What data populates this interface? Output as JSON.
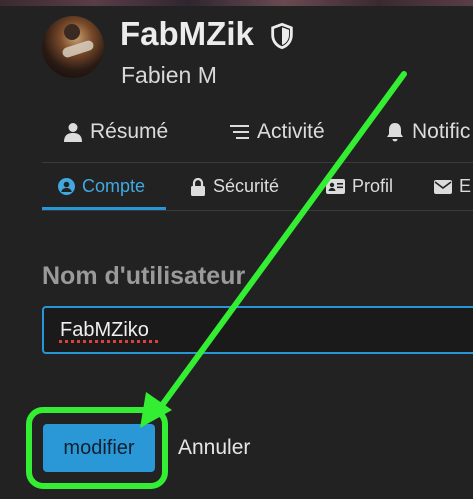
{
  "profile": {
    "username": "FabMZik",
    "real_name": "Fabien M"
  },
  "nav_primary": [
    {
      "label": "Résumé",
      "icon": "user-icon"
    },
    {
      "label": "Activité",
      "icon": "activity-list-icon"
    },
    {
      "label": "Notific",
      "icon": "bell-icon"
    }
  ],
  "nav_secondary": [
    {
      "label": "Compte",
      "icon": "user-circle-icon",
      "active": true
    },
    {
      "label": "Sécurité",
      "icon": "lock-icon"
    },
    {
      "label": "Profil",
      "icon": "id-card-icon"
    },
    {
      "label": "E",
      "icon": "envelope-icon"
    }
  ],
  "form": {
    "label": "Nom d'utilisateur",
    "value": "FabMZiko",
    "submit_label": "modifier",
    "cancel_label": "Annuler"
  },
  "colors": {
    "background": "#222222",
    "accent": "#2a95d6",
    "annotation": "#33ee33"
  }
}
